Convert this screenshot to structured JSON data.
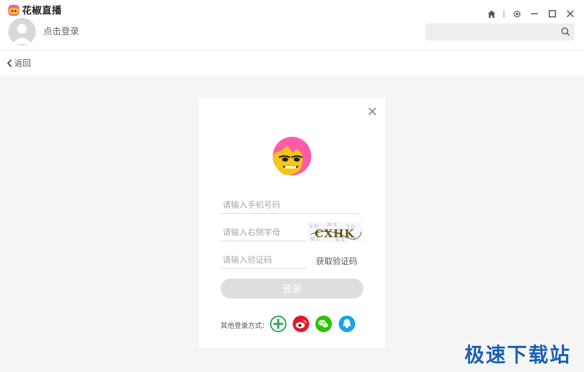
{
  "app": {
    "title": "花椒直播"
  },
  "header": {
    "login_prompt": "点击登录",
    "search_placeholder": "",
    "controls": [
      "home-icon",
      "gear-icon",
      "minimize-icon",
      "maximize-icon",
      "close-icon"
    ]
  },
  "nav": {
    "back_label": "返回"
  },
  "login": {
    "phone_placeholder": "请输入手机号码",
    "letters_placeholder": "请输入右侧字母",
    "captcha_text": "CXHK",
    "code_placeholder": "请输入验证码",
    "get_code_label": "获取验证码",
    "submit_label": "登录",
    "other_methods_label": "其他登录方式：",
    "social": [
      "360-icon",
      "weibo-icon",
      "wechat-icon",
      "qq-icon"
    ]
  },
  "watermark": "极速下载站",
  "colors": {
    "brand_pink": "#ff5aa8",
    "mascot_yellow": "#f5c518",
    "weibo": "#e6162d",
    "wechat": "#2dc100",
    "qq": "#1aa3e8",
    "green_360": "#2aa84f",
    "watermark": "#1a5fb4"
  }
}
